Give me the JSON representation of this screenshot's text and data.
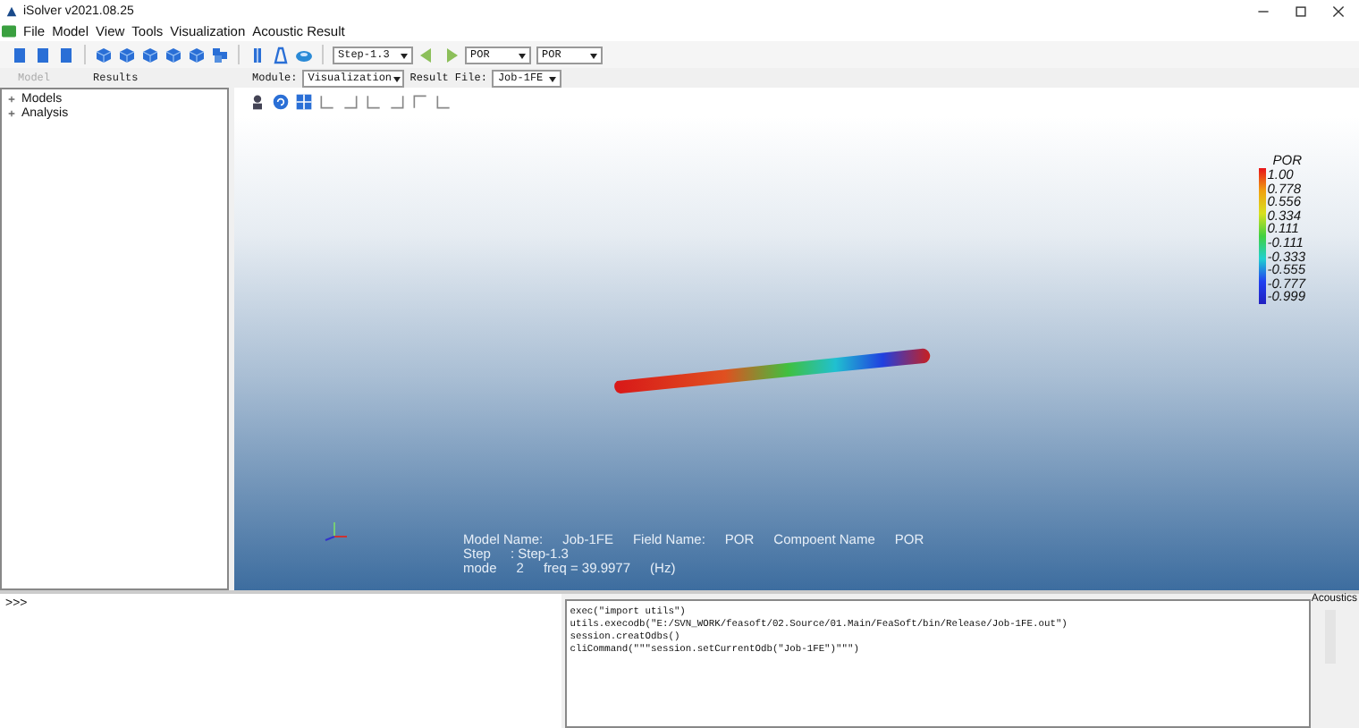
{
  "window": {
    "title": "iSolver v2021.08.25"
  },
  "menu": [
    "File",
    "Model",
    "View",
    "Tools",
    "Visualization",
    "Acoustic Result"
  ],
  "toolbar": {
    "step": "Step-1.3",
    "field": "POR",
    "component": "POR"
  },
  "panel_tabs": [
    {
      "label": "Model",
      "selected": false
    },
    {
      "label": "Results",
      "selected": true
    }
  ],
  "module": {
    "label": "Module:",
    "value": "Visualization"
  },
  "result_file": {
    "label": "Result File:",
    "value": "Job-1FE"
  },
  "tree": [
    {
      "label": "Models",
      "expanded": false
    },
    {
      "label": "Analysis",
      "expanded": false
    }
  ],
  "legend": {
    "title": "POR",
    "values": [
      "1.00",
      "0.778",
      "0.556",
      "0.334",
      "0.111",
      "-0.111",
      "-0.333",
      "-0.555",
      "-0.777",
      "-0.999"
    ]
  },
  "info_lines": [
    [
      "Model Name:",
      "Job-1FE",
      "Field Name:",
      "POR",
      "Compoent Name",
      "POR"
    ],
    [
      "Step",
      ": Step-1.3"
    ],
    [
      "mode",
      "2",
      "freq = 39.9977",
      "(Hz)"
    ]
  ],
  "console_prompt": ">>>",
  "log_lines": [
    "exec(\"import utils\")",
    "utils.execodb(\"E:/SVN_WORK/feasoft/02.Source/01.Main/FeaSoft/bin/Release/Job-1FE.out\")",
    "session.creatOdbs()",
    "cliCommand(\"\"\"session.setCurrentOdb(\"Job-1FE\")\"\"\")"
  ],
  "side_label": "Acoustics"
}
